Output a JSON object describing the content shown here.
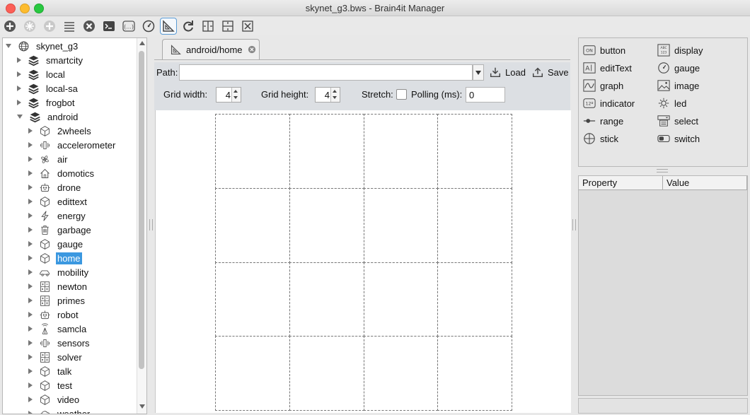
{
  "window": {
    "title": "skynet_g3.bws - Brain4it Manager"
  },
  "toolbar": {
    "buttons": [
      {
        "icon": "add-icon"
      },
      {
        "icon": "sparkle-icon"
      },
      {
        "icon": "add-circle-icon"
      },
      {
        "icon": "list-icon"
      },
      {
        "icon": "close-circle-icon"
      },
      {
        "icon": "terminal-icon"
      },
      {
        "icon": "parentheses-icon"
      },
      {
        "icon": "gauge-icon"
      },
      {
        "icon": "set-square-icon",
        "active": true
      },
      {
        "icon": "refresh-icon"
      },
      {
        "icon": "split-horizontal-icon"
      },
      {
        "icon": "split-vertical-icon"
      },
      {
        "icon": "close-box-icon"
      }
    ]
  },
  "tree": {
    "root": "skynet_g3",
    "modules": [
      {
        "label": "smartcity",
        "expanded": false
      },
      {
        "label": "local",
        "expanded": false
      },
      {
        "label": "local-sa",
        "expanded": false
      },
      {
        "label": "frogbot",
        "expanded": false
      },
      {
        "label": "android",
        "expanded": true
      }
    ],
    "android_children": [
      {
        "label": "2wheels",
        "icon": "cube-icon"
      },
      {
        "label": "accelerometer",
        "icon": "vibration-icon"
      },
      {
        "label": "air",
        "icon": "fan-icon"
      },
      {
        "label": "domotics",
        "icon": "house-icon"
      },
      {
        "label": "drone",
        "icon": "robot-icon"
      },
      {
        "label": "edittext",
        "icon": "cube-icon"
      },
      {
        "label": "energy",
        "icon": "lightning-icon"
      },
      {
        "label": "garbage",
        "icon": "trash-icon"
      },
      {
        "label": "gauge",
        "icon": "cube-icon"
      },
      {
        "label": "home",
        "icon": "cube-icon",
        "selected": true
      },
      {
        "label": "mobility",
        "icon": "car-icon"
      },
      {
        "label": "newton",
        "icon": "calculator-icon"
      },
      {
        "label": "primes",
        "icon": "calculator-icon"
      },
      {
        "label": "robot",
        "icon": "robot-icon"
      },
      {
        "label": "samcla",
        "icon": "antenna-icon"
      },
      {
        "label": "sensors",
        "icon": "vibration-icon"
      },
      {
        "label": "solver",
        "icon": "calculator-icon"
      },
      {
        "label": "talk",
        "icon": "cube-icon"
      },
      {
        "label": "test",
        "icon": "cube-icon"
      },
      {
        "label": "video",
        "icon": "cube-icon"
      },
      {
        "label": "weather",
        "icon": "cloud-icon"
      }
    ]
  },
  "editor": {
    "tab_label": "android/home",
    "path_label": "Path:",
    "path_value": "",
    "load_label": "Load",
    "save_label": "Save",
    "grid_width_label": "Grid width:",
    "grid_width": "4",
    "grid_height_label": "Grid height:",
    "grid_height": "4",
    "stretch_label": "Stretch:",
    "stretch_checked": false,
    "polling_label": "Polling (ms):",
    "polling_value": "0",
    "grid_cols": 4,
    "grid_rows": 4
  },
  "palette": {
    "items": [
      {
        "label": "button",
        "icon": "on-button-icon"
      },
      {
        "label": "display",
        "icon": "display-icon"
      },
      {
        "label": "editText",
        "icon": "edit-text-icon"
      },
      {
        "label": "gauge",
        "icon": "gauge-icon"
      },
      {
        "label": "graph",
        "icon": "graph-icon"
      },
      {
        "label": "image",
        "icon": "image-icon"
      },
      {
        "label": "indicator",
        "icon": "indicator-icon"
      },
      {
        "label": "led",
        "icon": "led-icon"
      },
      {
        "label": "range",
        "icon": "range-icon"
      },
      {
        "label": "select",
        "icon": "select-icon"
      },
      {
        "label": "stick",
        "icon": "stick-icon"
      },
      {
        "label": "switch",
        "icon": "switch-icon"
      }
    ]
  },
  "properties": {
    "col_property": "Property",
    "col_value": "Value"
  },
  "colors": {
    "selection": "#3b98e0",
    "toolbar_active": "#5a9bd5"
  }
}
